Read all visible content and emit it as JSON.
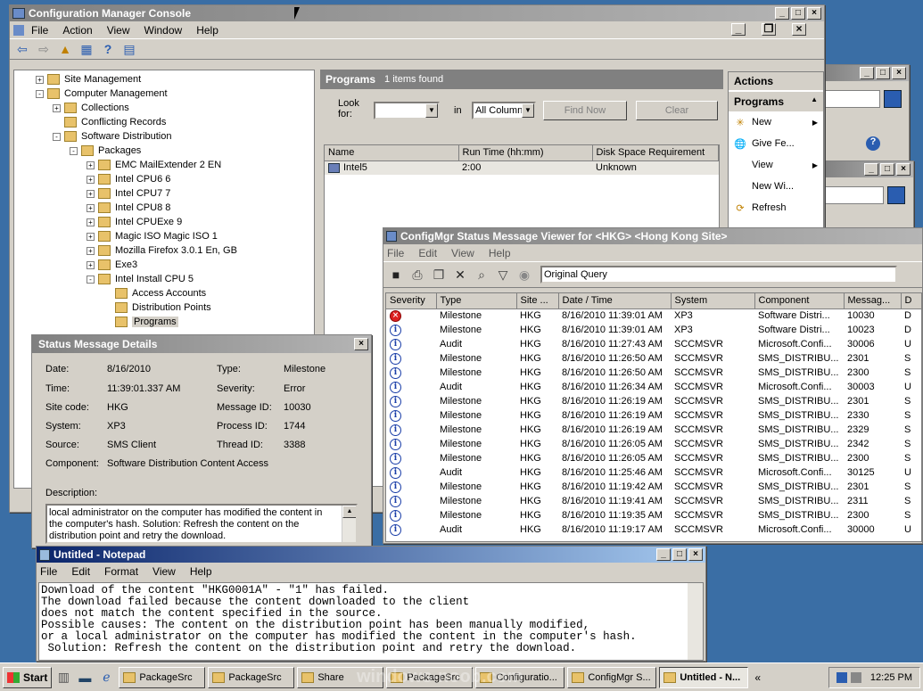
{
  "console": {
    "title": "Configuration Manager Console",
    "menu": [
      "File",
      "Action",
      "View",
      "Window",
      "Help"
    ],
    "tree": [
      {
        "label": "Site Management",
        "indent": 0,
        "exp": "+"
      },
      {
        "label": "Computer Management",
        "indent": 0,
        "exp": "-"
      },
      {
        "label": "Collections",
        "indent": 1,
        "exp": "+"
      },
      {
        "label": "Conflicting Records",
        "indent": 1,
        "exp": ""
      },
      {
        "label": "Software Distribution",
        "indent": 1,
        "exp": "-"
      },
      {
        "label": "Packages",
        "indent": 2,
        "exp": "-"
      },
      {
        "label": "EMC MailExtender 2 EN",
        "indent": 3,
        "exp": "+"
      },
      {
        "label": "Intel CPU6 6",
        "indent": 3,
        "exp": "+"
      },
      {
        "label": "Intel CPU7 7",
        "indent": 3,
        "exp": "+"
      },
      {
        "label": "Intel CPU8 8",
        "indent": 3,
        "exp": "+"
      },
      {
        "label": "Intel CPUExe 9",
        "indent": 3,
        "exp": "+"
      },
      {
        "label": "Magic ISO Magic ISO 1",
        "indent": 3,
        "exp": "+"
      },
      {
        "label": "Mozilla Firefox 3.0.1 En, GB",
        "indent": 3,
        "exp": "+"
      },
      {
        "label": "Exe3",
        "indent": 3,
        "exp": "+"
      },
      {
        "label": "Intel Install CPU 5",
        "indent": 3,
        "exp": "-"
      },
      {
        "label": "Access Accounts",
        "indent": 4,
        "exp": ""
      },
      {
        "label": "Distribution Points",
        "indent": 4,
        "exp": ""
      },
      {
        "label": "Programs",
        "indent": 4,
        "exp": "",
        "selected": true
      }
    ],
    "programs": {
      "header": "Programs",
      "count": "1 items found",
      "look_for_label": "Look for:",
      "in_label": "in",
      "look_for_value": "",
      "column_value": "All Columns",
      "find_now": "Find Now",
      "clear": "Clear",
      "columns": [
        "Name",
        "Run Time (hh:mm)",
        "Disk Space Requirement"
      ],
      "rows": [
        [
          "Intel5",
          "2:00",
          "Unknown"
        ]
      ]
    },
    "actions": {
      "header": "Actions",
      "section": "Programs",
      "items": [
        "New",
        "Give Fe...",
        "View",
        "New Wi...",
        "Refresh"
      ]
    }
  },
  "viewer": {
    "title": "ConfigMgr Status Message Viewer for <HKG> <Hong Kong Site>",
    "menu": [
      "File",
      "Edit",
      "View",
      "Help"
    ],
    "query": "Original Query",
    "columns": [
      "Severity",
      "Type",
      "Site ...",
      "Date / Time",
      "System",
      "Component",
      "Messag...",
      "D"
    ],
    "rows": [
      {
        "sev": "error",
        "type": "Milestone",
        "site": "HKG",
        "date": "8/16/2010 11:39:01 AM",
        "system": "XP3",
        "component": "Software Distri...",
        "msg": "10030",
        "d": "D"
      },
      {
        "sev": "info",
        "type": "Milestone",
        "site": "HKG",
        "date": "8/16/2010 11:39:01 AM",
        "system": "XP3",
        "component": "Software Distri...",
        "msg": "10023",
        "d": "D"
      },
      {
        "sev": "info",
        "type": "Audit",
        "site": "HKG",
        "date": "8/16/2010 11:27:43 AM",
        "system": "SCCMSVR",
        "component": "Microsoft.Confi...",
        "msg": "30006",
        "d": "U"
      },
      {
        "sev": "info",
        "type": "Milestone",
        "site": "HKG",
        "date": "8/16/2010 11:26:50 AM",
        "system": "SCCMSVR",
        "component": "SMS_DISTRIBU...",
        "msg": "2301",
        "d": "S"
      },
      {
        "sev": "info",
        "type": "Milestone",
        "site": "HKG",
        "date": "8/16/2010 11:26:50 AM",
        "system": "SCCMSVR",
        "component": "SMS_DISTRIBU...",
        "msg": "2300",
        "d": "S"
      },
      {
        "sev": "info",
        "type": "Audit",
        "site": "HKG",
        "date": "8/16/2010 11:26:34 AM",
        "system": "SCCMSVR",
        "component": "Microsoft.Confi...",
        "msg": "30003",
        "d": "U"
      },
      {
        "sev": "info",
        "type": "Milestone",
        "site": "HKG",
        "date": "8/16/2010 11:26:19 AM",
        "system": "SCCMSVR",
        "component": "SMS_DISTRIBU...",
        "msg": "2301",
        "d": "S"
      },
      {
        "sev": "info",
        "type": "Milestone",
        "site": "HKG",
        "date": "8/16/2010 11:26:19 AM",
        "system": "SCCMSVR",
        "component": "SMS_DISTRIBU...",
        "msg": "2330",
        "d": "S"
      },
      {
        "sev": "info",
        "type": "Milestone",
        "site": "HKG",
        "date": "8/16/2010 11:26:19 AM",
        "system": "SCCMSVR",
        "component": "SMS_DISTRIBU...",
        "msg": "2329",
        "d": "S"
      },
      {
        "sev": "info",
        "type": "Milestone",
        "site": "HKG",
        "date": "8/16/2010 11:26:05 AM",
        "system": "SCCMSVR",
        "component": "SMS_DISTRIBU...",
        "msg": "2342",
        "d": "S"
      },
      {
        "sev": "info",
        "type": "Milestone",
        "site": "HKG",
        "date": "8/16/2010 11:26:05 AM",
        "system": "SCCMSVR",
        "component": "SMS_DISTRIBU...",
        "msg": "2300",
        "d": "S"
      },
      {
        "sev": "info",
        "type": "Audit",
        "site": "HKG",
        "date": "8/16/2010 11:25:46 AM",
        "system": "SCCMSVR",
        "component": "Microsoft.Confi...",
        "msg": "30125",
        "d": "U"
      },
      {
        "sev": "info",
        "type": "Milestone",
        "site": "HKG",
        "date": "8/16/2010 11:19:42 AM",
        "system": "SCCMSVR",
        "component": "SMS_DISTRIBU...",
        "msg": "2301",
        "d": "S"
      },
      {
        "sev": "info",
        "type": "Milestone",
        "site": "HKG",
        "date": "8/16/2010 11:19:41 AM",
        "system": "SCCMSVR",
        "component": "SMS_DISTRIBU...",
        "msg": "2311",
        "d": "S"
      },
      {
        "sev": "info",
        "type": "Milestone",
        "site": "HKG",
        "date": "8/16/2010 11:19:35 AM",
        "system": "SCCMSVR",
        "component": "SMS_DISTRIBU...",
        "msg": "2300",
        "d": "S"
      },
      {
        "sev": "info",
        "type": "Audit",
        "site": "HKG",
        "date": "8/16/2010 11:19:17 AM",
        "system": "SCCMSVR",
        "component": "Microsoft.Confi...",
        "msg": "30000",
        "d": "U"
      }
    ]
  },
  "details": {
    "title": "Status Message Details",
    "date_label": "Date:",
    "date": "8/16/2010",
    "time_label": "Time:",
    "time": "11:39:01.337 AM",
    "site_label": "Site code:",
    "site": "HKG",
    "system_label": "System:",
    "system": "XP3",
    "source_label": "Source:",
    "source": "SMS Client",
    "component_label": "Component:",
    "component": "Software Distribution Content Access",
    "type_label": "Type:",
    "type": "Milestone",
    "severity_label": "Severity:",
    "severity": "Error",
    "msgid_label": "Message ID:",
    "msgid": "10030",
    "process_label": "Process ID:",
    "process": "1744",
    "thread_label": "Thread ID:",
    "thread": "3388",
    "description_label": "Description:",
    "description": "local administrator on the computer has modified the content in the computer's hash. Solution: Refresh the content on the distribution point and retry the download."
  },
  "notepad": {
    "title": "Untitled - Notepad",
    "menu": [
      "File",
      "Edit",
      "Format",
      "View",
      "Help"
    ],
    "lines": [
      "Download of the content \"HKG0001A\" - \"1\" has failed.",
      "The download failed because the content downloaded to the client",
      "does not match the content specified in the source.",
      "Possible causes: The content on the distribution point has been manually modified,",
      "or a local administrator on the computer has modified the content in the computer's hash.",
      " Solution: Refresh the content on the distribution point and retry the download."
    ]
  },
  "taskbar": {
    "start": "Start",
    "items": [
      "PackageSrc",
      "PackageSrc",
      "Share",
      "PackageSrc",
      "Configuratio...",
      "ConfigMgr S...",
      "Untitled - N..."
    ],
    "active_index": 6,
    "chevron": "«",
    "clock": "12:25 PM"
  },
  "watermark": "windows-noob.com"
}
